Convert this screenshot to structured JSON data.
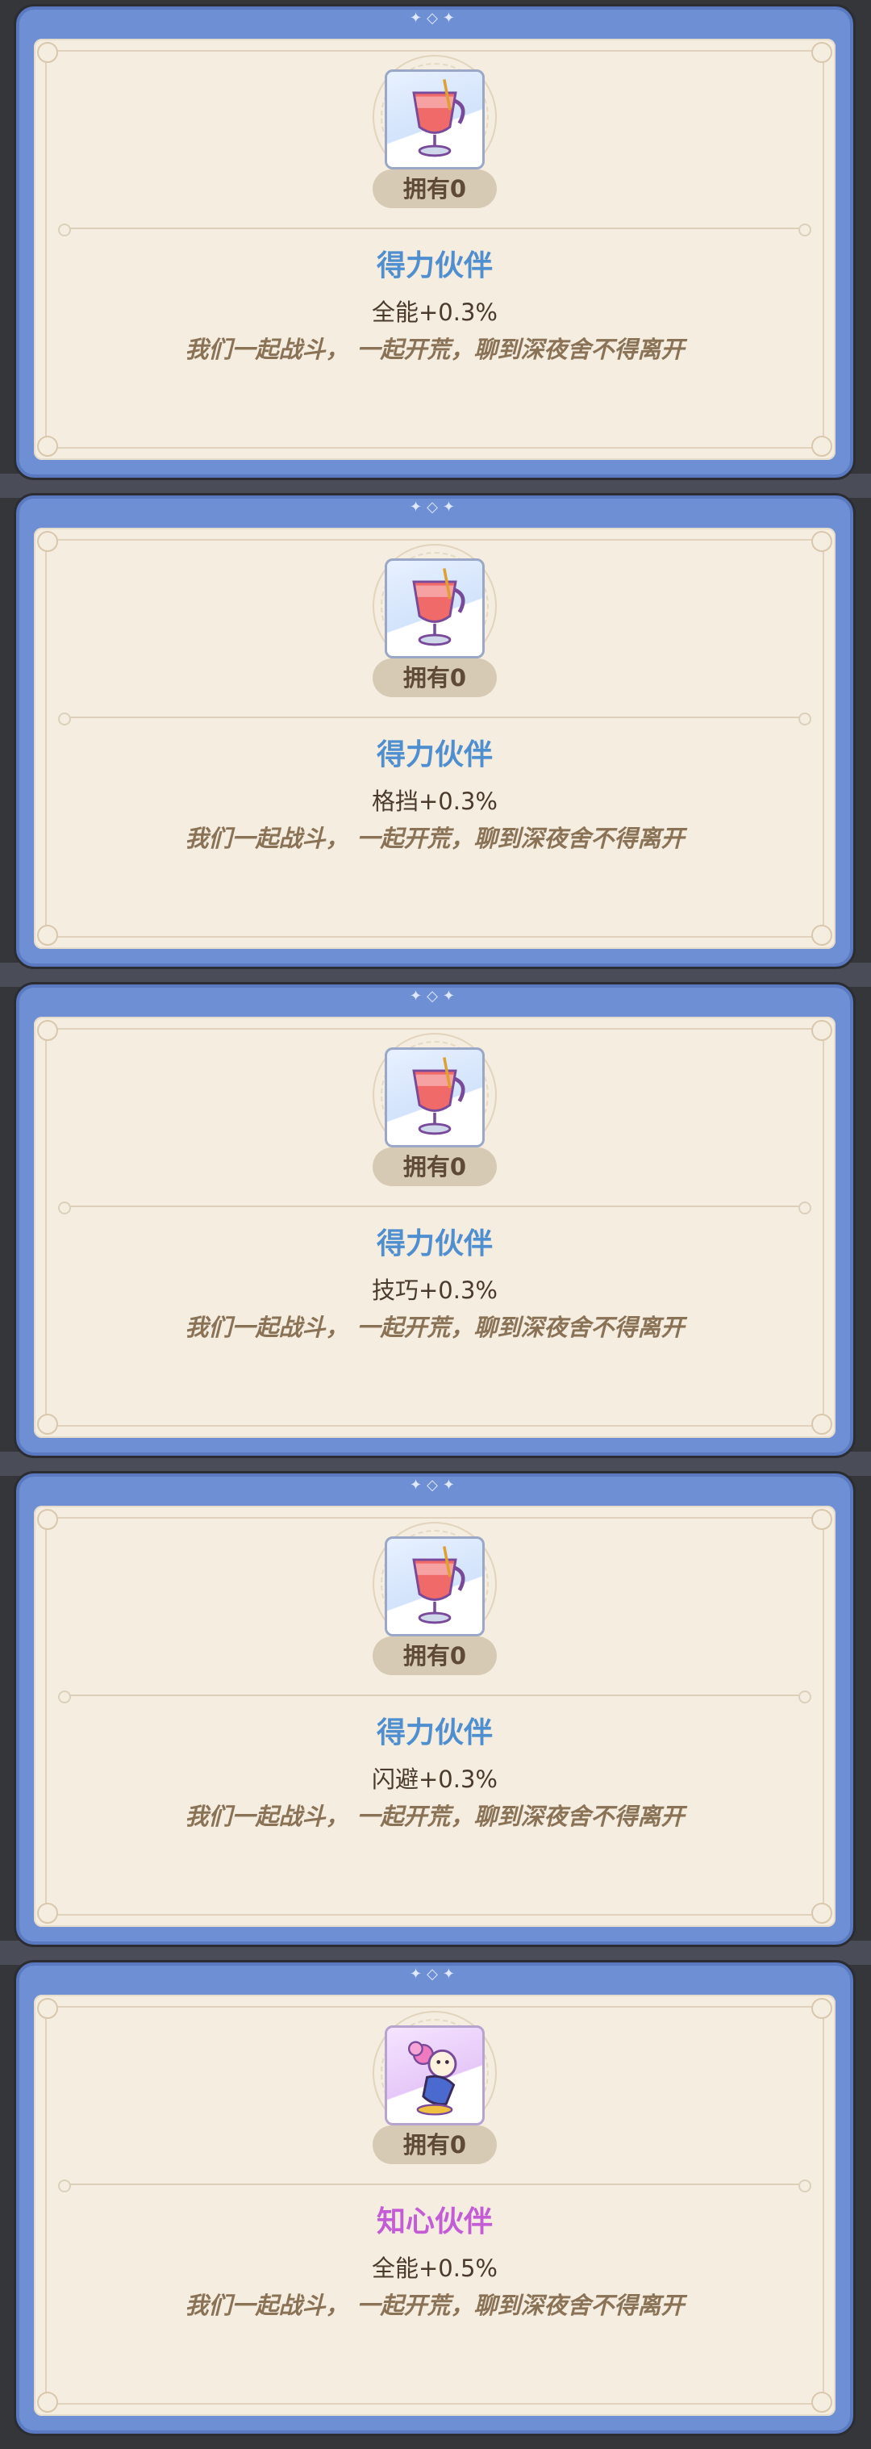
{
  "cards": [
    {
      "owned": "拥有0",
      "title": "得力伙伴",
      "stat": "全能+0.3%",
      "flavor": "我们一起战斗， 一起开荒，聊到深夜舍不得离开",
      "theme": "blue",
      "icon": "cocktail-glass-icon"
    },
    {
      "owned": "拥有0",
      "title": "得力伙伴",
      "stat": "格挡+0.3%",
      "flavor": "我们一起战斗， 一起开荒，聊到深夜舍不得离开",
      "theme": "blue",
      "icon": "cocktail-glass-icon"
    },
    {
      "owned": "拥有0",
      "title": "得力伙伴",
      "stat": "技巧+0.3%",
      "flavor": "我们一起战斗， 一起开荒，聊到深夜舍不得离开",
      "theme": "blue",
      "icon": "cocktail-glass-icon"
    },
    {
      "owned": "拥有0",
      "title": "得力伙伴",
      "stat": "闪避+0.3%",
      "flavor": "我们一起战斗， 一起开荒，聊到深夜舍不得离开",
      "theme": "blue",
      "icon": "cocktail-glass-icon"
    },
    {
      "owned": "拥有0",
      "title": "知心伙伴",
      "stat": "全能+0.5%",
      "flavor": "我们一起战斗， 一起开荒，聊到深夜舍不得离开",
      "theme": "purple",
      "icon": "flower-doll-icon"
    }
  ],
  "colors": {
    "frame": "#6e8fd4",
    "panel": "#f4ede0",
    "title_blue": "#4f8fd0",
    "title_purple": "#c45cd6"
  }
}
